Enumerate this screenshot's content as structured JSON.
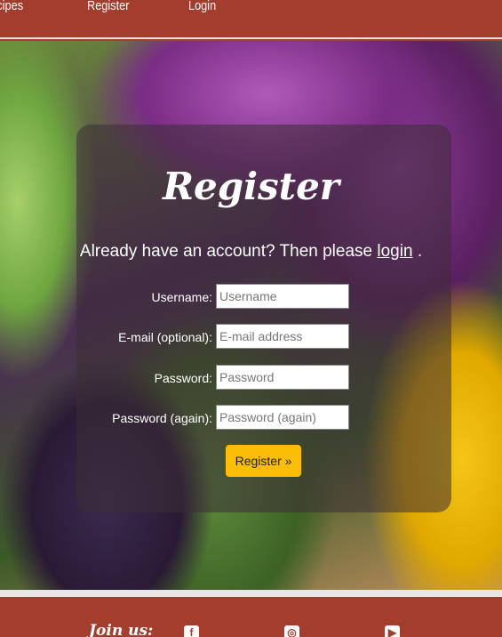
{
  "nav": {
    "items": [
      {
        "label": "Recipes"
      },
      {
        "label": "Register"
      },
      {
        "label": "Login"
      }
    ]
  },
  "form": {
    "title": "Register",
    "subtitle_prefix": "Already have an account? Then please",
    "login_link": "login",
    "subtitle_suffix": ".",
    "fields": [
      {
        "label": "Username:",
        "placeholder": "Username",
        "value": ""
      },
      {
        "label": "E-mail (optional):",
        "placeholder": "E-mail address",
        "value": ""
      },
      {
        "label": "Password:",
        "placeholder": "Password",
        "value": ""
      },
      {
        "label": "Password (again):",
        "placeholder": "Password (again)",
        "value": ""
      }
    ],
    "submit_label": "Register »"
  },
  "footer": {
    "join_label": "Join us:",
    "social": [
      {
        "icon": "facebook-icon"
      },
      {
        "icon": "instagram-icon"
      },
      {
        "icon": "youtube-icon"
      }
    ]
  },
  "colors": {
    "brand": "#a33d2e",
    "button": "#fbbd08"
  }
}
